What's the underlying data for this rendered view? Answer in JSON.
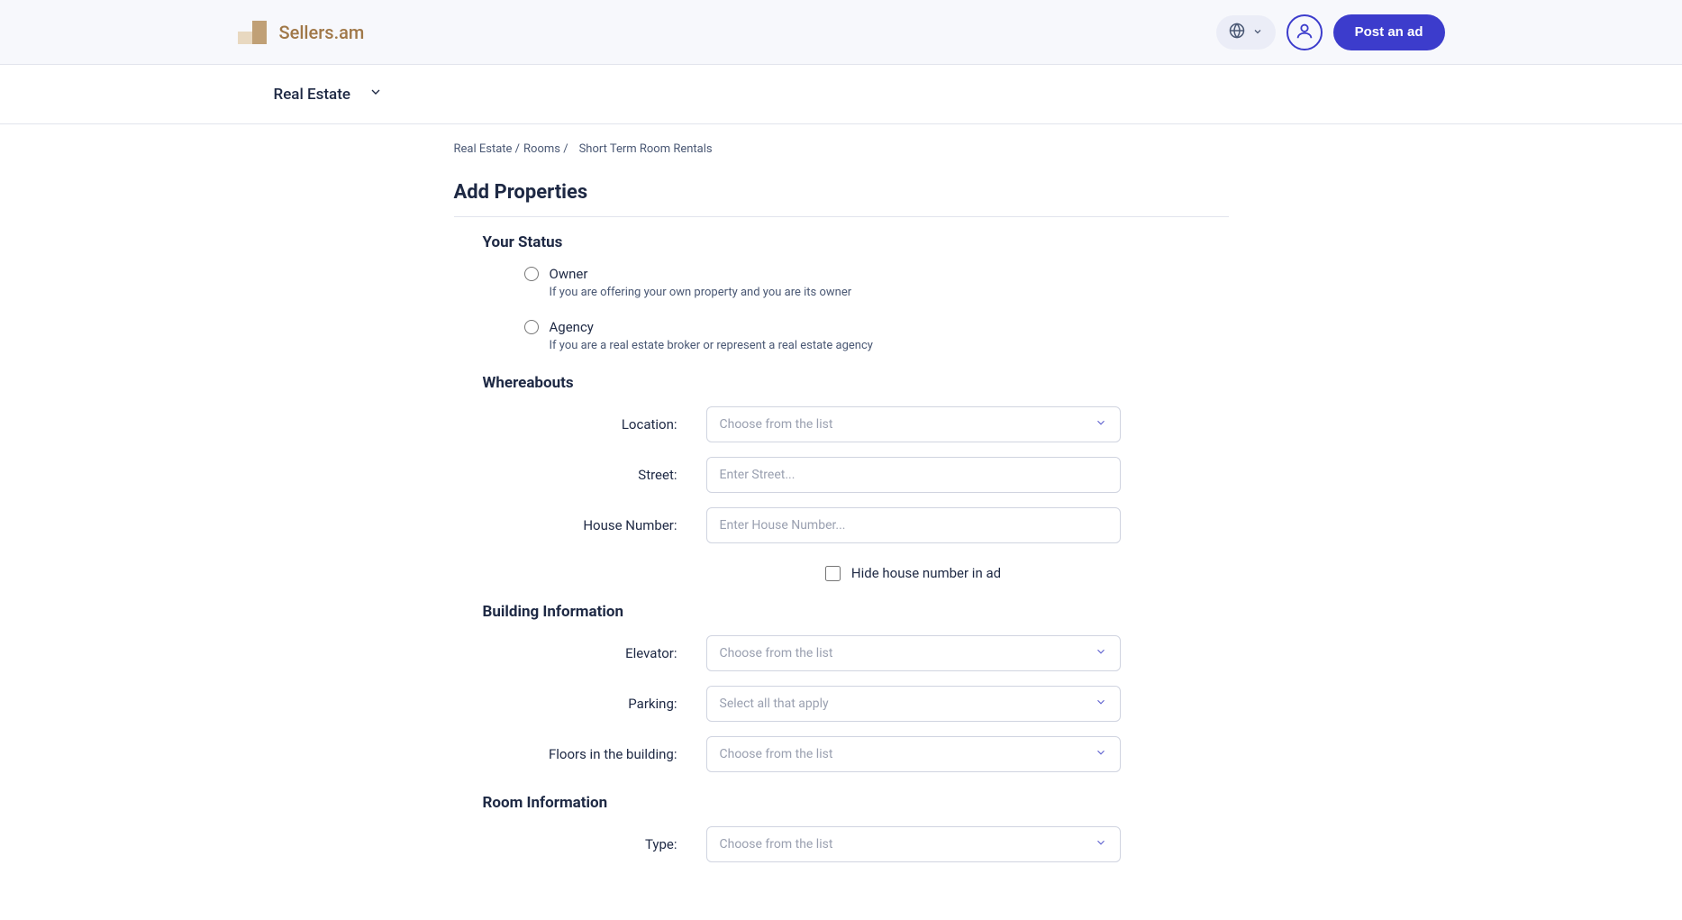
{
  "header": {
    "brand": "Sellers.am",
    "post_ad_label": "Post an ad"
  },
  "subheader": {
    "category_label": "Real Estate"
  },
  "breadcrumb": {
    "part1": "Real Estate",
    "part2": "Rooms",
    "current": "Short Term Room Rentals"
  },
  "page": {
    "title": "Add Properties"
  },
  "sections": {
    "status": {
      "title": "Your Status",
      "owner_label": "Owner",
      "owner_desc": "If you are offering your own property and you are its owner",
      "agency_label": "Agency",
      "agency_desc": "If you are a real estate broker or represent a real estate agency"
    },
    "whereabouts": {
      "title": "Whereabouts",
      "location_label": "Location:",
      "location_placeholder": "Choose from the list",
      "street_label": "Street:",
      "street_placeholder": "Enter Street...",
      "house_label": "House Number:",
      "house_placeholder": "Enter House Number...",
      "hide_house_label": "Hide house number in ad"
    },
    "building": {
      "title": "Building Information",
      "elevator_label": "Elevator:",
      "elevator_placeholder": "Choose from the list",
      "parking_label": "Parking:",
      "parking_placeholder": "Select all that apply",
      "floors_label": "Floors in the building:",
      "floors_placeholder": "Choose from the list"
    },
    "room": {
      "title": "Room Information",
      "type_label": "Type:",
      "type_placeholder": "Choose from the list"
    }
  }
}
